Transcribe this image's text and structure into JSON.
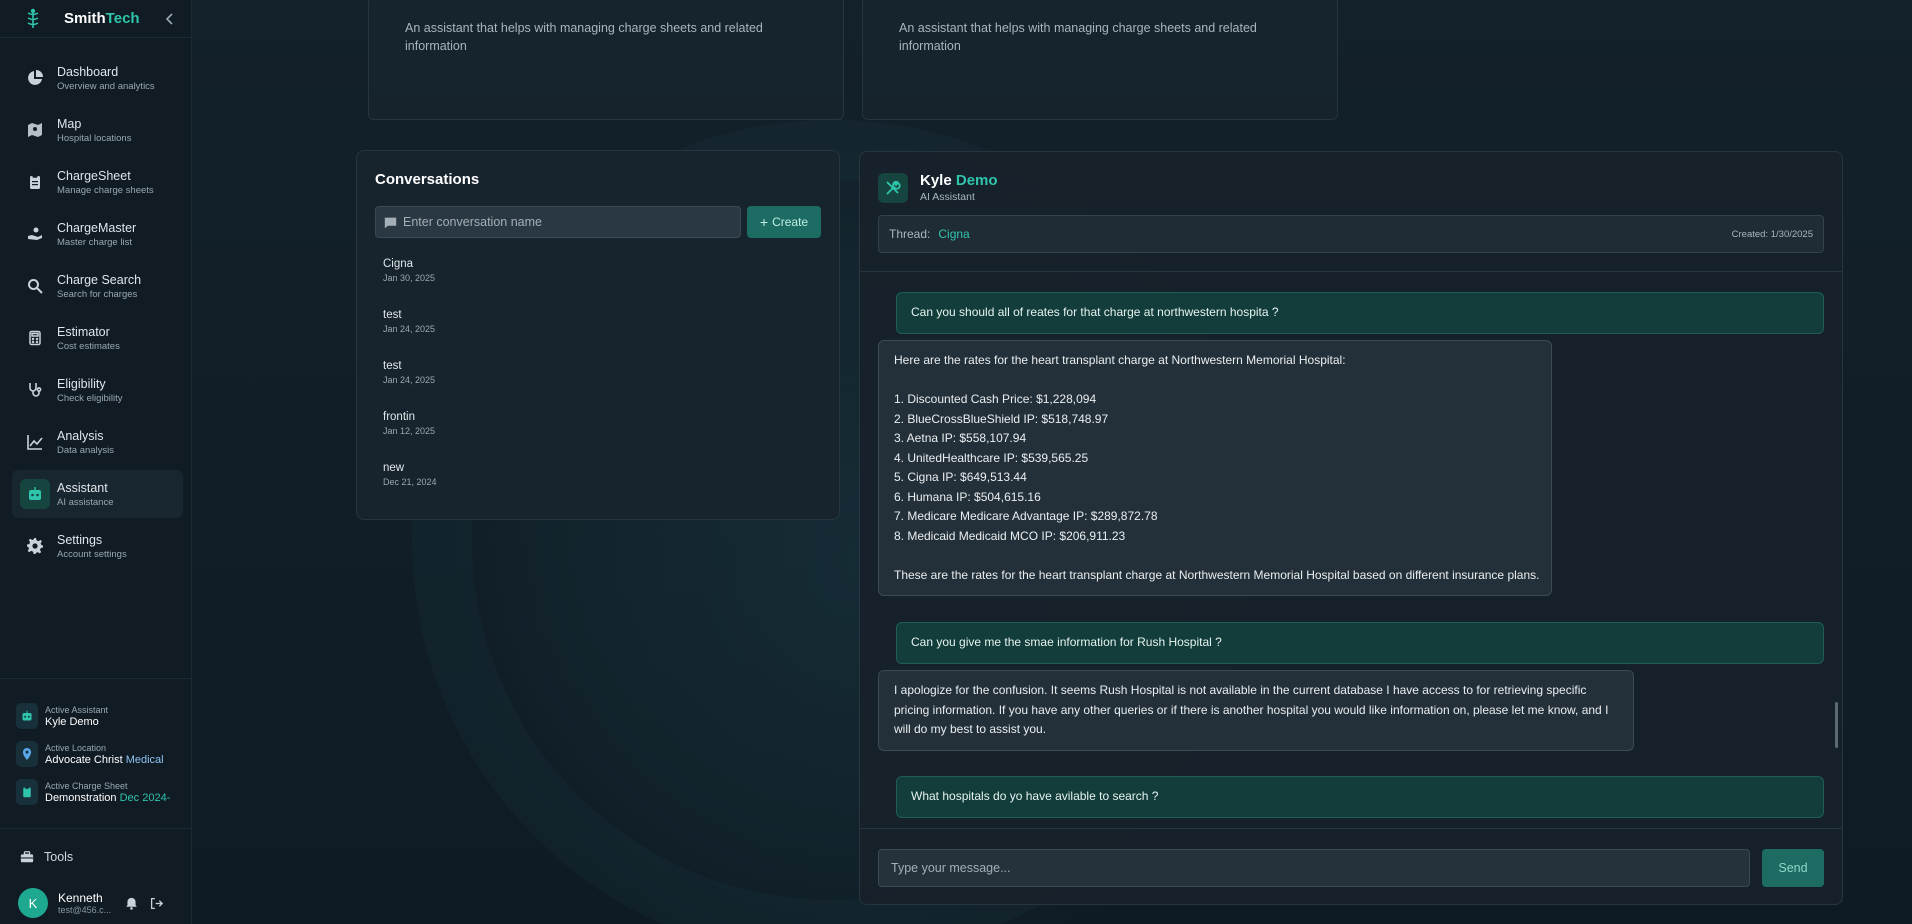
{
  "brand": {
    "name": "Smith",
    "accent": "Tech"
  },
  "nav": [
    {
      "label": "Dashboard",
      "sub": "Overview and analytics",
      "icon": "pie-chart-icon"
    },
    {
      "label": "Map",
      "sub": "Hospital locations",
      "icon": "map-icon"
    },
    {
      "label": "ChargeSheet",
      "sub": "Manage charge sheets",
      "icon": "clipboard-icon"
    },
    {
      "label": "ChargeMaster",
      "sub": "Master charge list",
      "icon": "hand-coins-icon"
    },
    {
      "label": "Charge Search",
      "sub": "Search for charges",
      "icon": "search-icon"
    },
    {
      "label": "Estimator",
      "sub": "Cost estimates",
      "icon": "calculator-icon"
    },
    {
      "label": "Eligibility",
      "sub": "Check eligibility",
      "icon": "stethoscope-icon"
    },
    {
      "label": "Analysis",
      "sub": "Data analysis",
      "icon": "line-chart-icon"
    },
    {
      "label": "Assistant",
      "sub": "AI assistance",
      "icon": "bot-icon"
    },
    {
      "label": "Settings",
      "sub": "Account settings",
      "icon": "gear-icon"
    }
  ],
  "status": {
    "assistant": {
      "label": "Active Assistant",
      "value": "Kyle Demo"
    },
    "location": {
      "label": "Active Location",
      "value": "Advocate Christ",
      "accent": "Medical"
    },
    "sheet": {
      "label": "Active Charge Sheet",
      "value": "Demonstration",
      "accent": "Dec 2024-"
    }
  },
  "tools": {
    "label": "Tools"
  },
  "user": {
    "initial": "K",
    "name": "Kenneth",
    "email": "test@456.c..."
  },
  "top_cards": [
    {
      "desc": "An assistant that helps with managing charge sheets and related information"
    },
    {
      "desc": "An assistant that helps with managing charge sheets and related information"
    }
  ],
  "conversations": {
    "title": "Conversations",
    "placeholder": "Enter conversation name",
    "create_label": "Create",
    "items": [
      {
        "name": "Cigna",
        "date": "Jan 30, 2025"
      },
      {
        "name": "test",
        "date": "Jan 24, 2025"
      },
      {
        "name": "test",
        "date": "Jan 24, 2025"
      },
      {
        "name": "frontin",
        "date": "Jan 12, 2025"
      },
      {
        "name": "new",
        "date": "Dec 21, 2024"
      }
    ]
  },
  "chat": {
    "bot_name": "Kyle",
    "bot_name_accent": "Demo",
    "bot_role": "AI Assistant",
    "thread_label": "Thread:",
    "thread_name": "Cigna",
    "created": "Created: 1/30/2025",
    "messages": [
      {
        "role": "user",
        "lines": [
          "Can you should all of reates for that charge at northwestern hospita ?"
        ]
      },
      {
        "role": "bot",
        "lines": [
          "Here are the rates for the heart transplant charge at Northwestern Memorial Hospital:",
          "",
          "1. Discounted Cash Price: $1,228,094",
          "2. BlueCrossBlueShield IP: $518,748.97",
          "3. Aetna IP: $558,107.94",
          "4. UnitedHealthcare IP: $539,565.25",
          "5. Cigna IP: $649,513.44",
          "6. Humana IP: $504,615.16",
          "7. Medicare Medicare Advantage IP: $289,872.78",
          "8. Medicaid Medicaid MCO IP: $206,911.23",
          "",
          "These are the rates for the heart transplant charge at Northwestern Memorial Hospital based on different insurance plans."
        ]
      },
      {
        "role": "user",
        "lines": [
          "Can you give me the smae information for Rush Hospital ?"
        ]
      },
      {
        "role": "bot",
        "lines": [
          "I apologize for the confusion. It seems Rush Hospital is not available in the current database I have access to for retrieving specific",
          "pricing information. If you have any other queries or if there is another hospital you would like information on, please let me know, and I",
          "will do my best to assist you."
        ]
      },
      {
        "role": "user",
        "lines": [
          "What hospitals do yo have avilable to search ?"
        ]
      }
    ],
    "input_placeholder": "Type your message...",
    "send_label": "Send"
  },
  "colors": {
    "accent": "#2fc5ad",
    "background": "#0f1a22",
    "panel": "#18242e",
    "user_bubble": "#123d3a"
  }
}
